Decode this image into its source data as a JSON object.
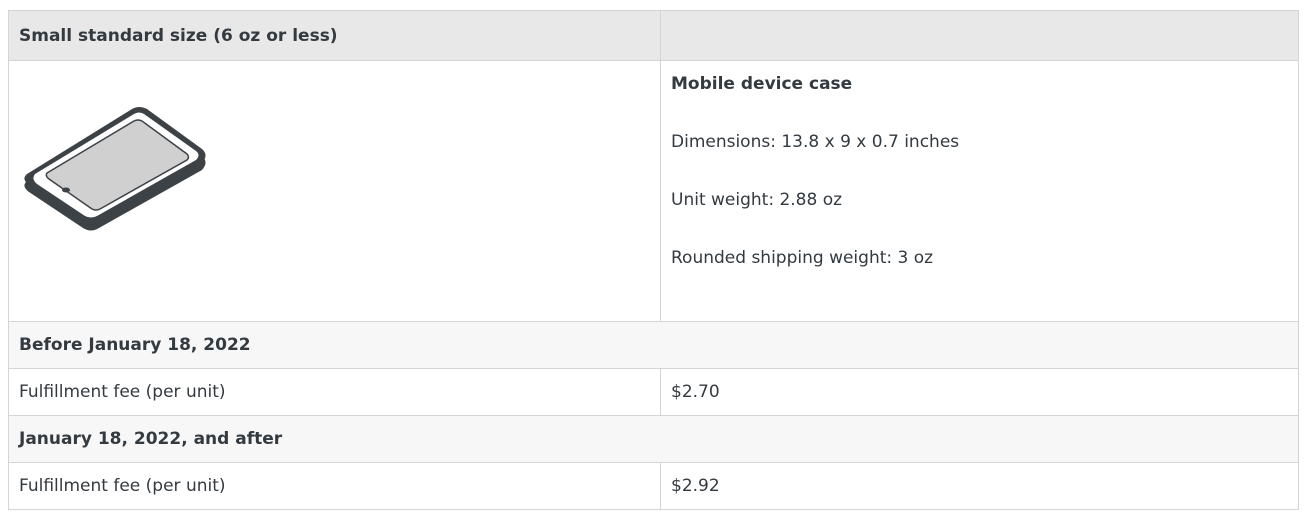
{
  "header": {
    "size_tier": "Small standard size (6 oz or less)",
    "empty": ""
  },
  "product": {
    "icon": "tablet-icon",
    "name": "Mobile device case",
    "dimensions": "Dimensions: 13.8 x 9 x 0.7 inches",
    "unit_weight": "Unit weight: 2.88 oz",
    "shipping_weight": "Rounded shipping weight: 3 oz"
  },
  "periods": [
    {
      "label": "Before January 18, 2022",
      "fee_label": "Fulfillment fee (per unit)",
      "fee_value": "$2.70"
    },
    {
      "label": "January 18, 2022, and after",
      "fee_label": "Fulfillment fee (per unit)",
      "fee_value": "$2.92"
    }
  ],
  "colors": {
    "border": "#d3d5d6",
    "header_bg": "#e8e8e8",
    "section_bg": "#f7f7f7",
    "text": "#333a40",
    "tablet_dark": "#3d4247",
    "tablet_screen": "#d0d0d0"
  }
}
